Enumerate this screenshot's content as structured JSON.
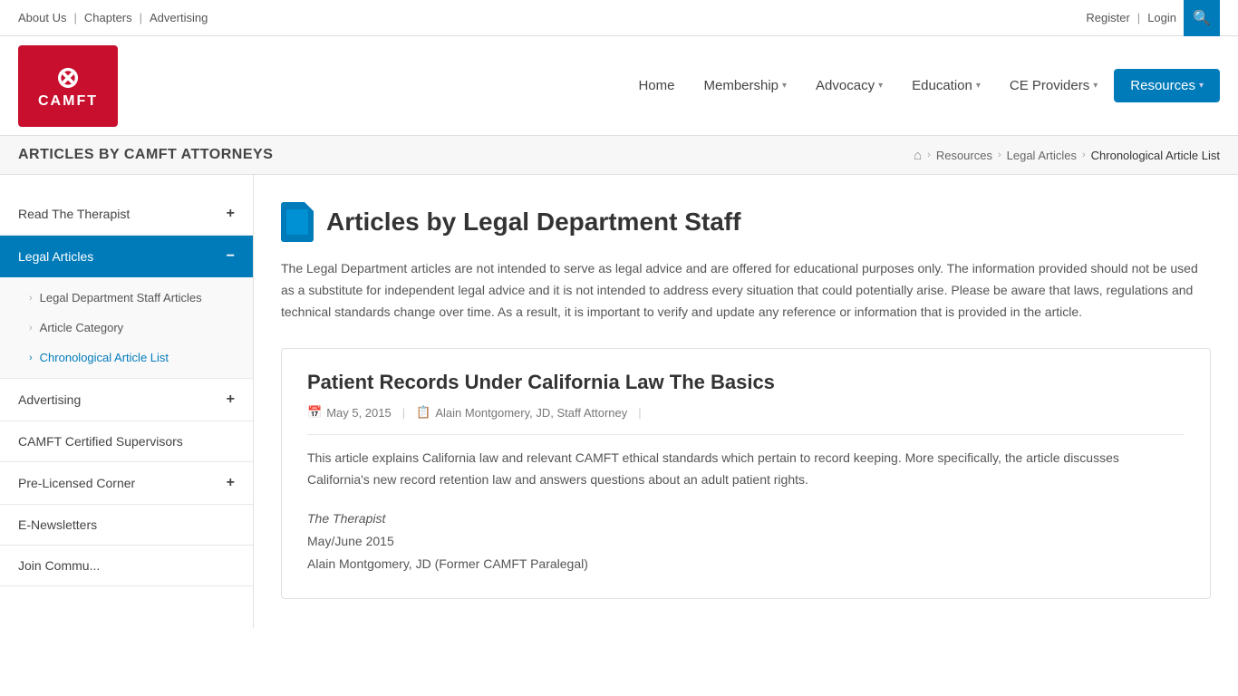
{
  "topbar": {
    "links": [
      "About Us",
      "Chapters",
      "Advertising"
    ],
    "seps": [
      "|",
      "|"
    ],
    "auth": [
      "Register",
      "Login"
    ],
    "auth_sep": "|"
  },
  "nav": {
    "home": "Home",
    "membership": "Membership",
    "advocacy": "Advocacy",
    "education": "Education",
    "ce_providers": "CE Providers",
    "resources": "Resources"
  },
  "page_title": "ARTICLES BY CAMFT ATTORNEYS",
  "breadcrumb": {
    "home_icon": "⌂",
    "resources": "Resources",
    "legal_articles": "Legal Articles",
    "current": "Chronological Article List"
  },
  "sidebar": {
    "items": [
      {
        "label": "Read The Therapist",
        "active": false,
        "icon": "+",
        "id": "read-therapist"
      },
      {
        "label": "Legal Articles",
        "active": true,
        "icon": "−",
        "id": "legal-articles",
        "subitems": [
          {
            "label": "Legal Department Staff Articles",
            "active": false
          },
          {
            "label": "Article Category",
            "active": false
          },
          {
            "label": "Chronological Article List",
            "active": true
          }
        ]
      },
      {
        "label": "Advertising",
        "active": false,
        "icon": "+",
        "id": "advertising"
      },
      {
        "label": "CAMFT Certified Supervisors",
        "active": false,
        "icon": "",
        "id": "camft-certified"
      },
      {
        "label": "Pre-Licensed Corner",
        "active": false,
        "icon": "+",
        "id": "pre-licensed"
      },
      {
        "label": "E-Newsletters",
        "active": false,
        "icon": "",
        "id": "e-newsletters"
      },
      {
        "label": "Join Commu...",
        "active": false,
        "icon": "",
        "id": "join-community"
      }
    ]
  },
  "main": {
    "heading": "Articles by Legal Department Staff",
    "description": "The Legal Department articles are not intended to serve as legal advice and are offered for educational purposes only. The information provided should not be used as a substitute for independent legal advice and it is not intended to address every situation that could potentially arise. Please be aware that laws, regulations and technical standards change over time. As a result, it is important to verify and update any reference or information that is provided in the article.",
    "article": {
      "title": "Patient Records Under California Law The Basics",
      "date": "May 5, 2015",
      "author": "Alain Montgomery, JD, Staff Attorney",
      "excerpt": "This article explains California law and relevant CAMFT ethical standards which pertain to record keeping. More specifically, the article discusses California's new record retention law and answers questions about an adult patient rights.",
      "source_title": "The Therapist",
      "source_date": "May/June 2015",
      "source_author": "Alain Montgomery, JD (Former CAMFT Paralegal)"
    }
  }
}
